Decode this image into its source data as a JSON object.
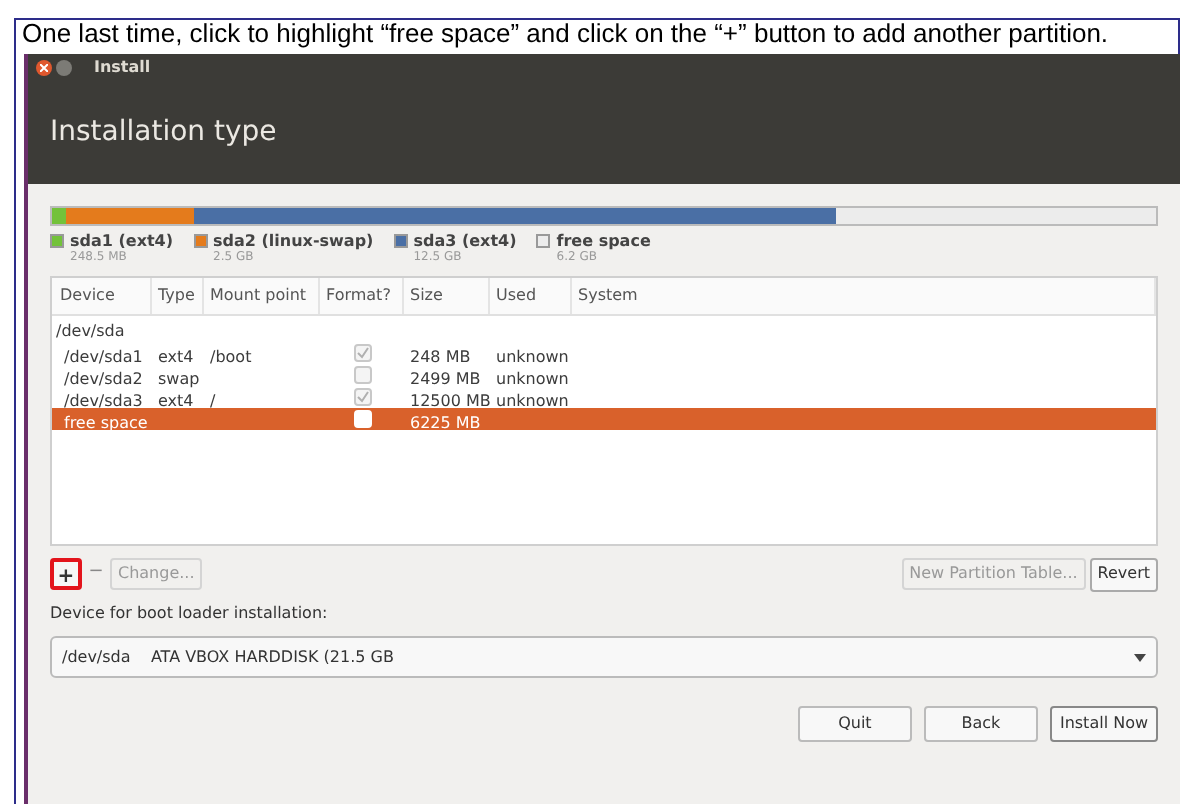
{
  "caption": "One last time, click to highlight “free space” and click on the “+” button to add another partition.",
  "window": {
    "title": "Install",
    "heading": "Installation type"
  },
  "partitions": [
    {
      "name": "sda1 (ext4)",
      "size": "248.5 MB",
      "color": "#73c23a"
    },
    {
      "name": "sda2 (linux-swap)",
      "size": "2.5 GB",
      "color": "#e47b1c"
    },
    {
      "name": "sda3 (ext4)",
      "size": "12.5 GB",
      "color": "#4a6fa5"
    },
    {
      "name": "free space",
      "size": "6.2 GB",
      "color": "#ececec"
    }
  ],
  "disk_bar": [
    {
      "color": "#73c23a",
      "level": 0.013
    },
    {
      "color": "#e47b1c",
      "level": 0.129
    },
    {
      "color": "#4a6fa5",
      "level": 0.711
    }
  ],
  "table": {
    "columns": [
      "Device",
      "Type",
      "Mount point",
      "Format?",
      "Size",
      "Used",
      "System"
    ],
    "rows": [
      {
        "kind": "disk",
        "device": "/dev/sda",
        "selected": false
      },
      {
        "kind": "partition",
        "device": "/dev/sda1",
        "type": "ext4",
        "mount": "/boot",
        "checked": true,
        "size": "248 MB",
        "used": "unknown",
        "selected": false
      },
      {
        "kind": "partition",
        "device": "/dev/sda2",
        "type": "swap",
        "checked": false,
        "size": "2499 MB",
        "used": "unknown",
        "selected": false
      },
      {
        "kind": "partition",
        "device": "/dev/sda3",
        "type": "ext4",
        "mount": "/",
        "checked": true,
        "size": "12500 MB",
        "used": "unknown",
        "selected": false
      },
      {
        "kind": "partition",
        "device": "free space",
        "checked": false,
        "size": "6225 MB",
        "selected": true
      }
    ]
  },
  "tools": {
    "add": "+",
    "remove": "−",
    "change": "Change...",
    "new_table": "New Partition Table...",
    "revert": "Revert",
    "highlight_add": true
  },
  "bootloader": {
    "label": "Device for boot loader installation:",
    "value": "/dev/sda    ATA VBOX HARDDISK (21.5 GB"
  },
  "buttons": [
    "Quit",
    "Back",
    "Install Now"
  ]
}
